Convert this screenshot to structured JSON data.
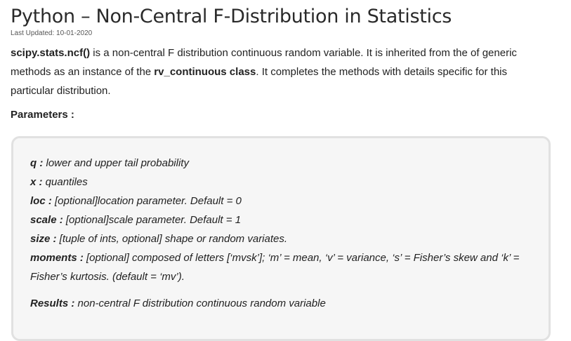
{
  "article": {
    "title": "Python – Non-Central F-Distribution in Statistics",
    "last_updated": "Last Updated: 10-01-2020",
    "intro": {
      "code1": "scipy.stats.ncf()",
      "text1": " is a non-central F distribution continuous random variable. It is inherited from the of generic methods as an instance of the ",
      "code2": "rv_continuous class",
      "text2": ". It completes the methods with details specific for this particular distribution."
    },
    "parameters_heading": "Parameters :",
    "parameters": [
      {
        "key": "q :",
        "desc": " lower and upper tail probability"
      },
      {
        "key": "x :",
        "desc": " quantiles"
      },
      {
        "key": "loc :",
        "desc": " [optional]location parameter. Default = 0"
      },
      {
        "key": "scale :",
        "desc": " [optional]scale parameter. Default = 1"
      },
      {
        "key": "size :",
        "desc": " [tuple of ints, optional] shape or random variates."
      },
      {
        "key": "moments :",
        "desc": " [optional] composed of letters [‘mvsk’]; ‘m’ = mean, ‘v’ = variance, ‘s’ = Fisher’s skew and ‘k’ = Fisher’s kurtosis. (default = ‘mv’)."
      }
    ],
    "results": {
      "key": "Results :",
      "desc": " non-central F distribution continuous random variable"
    }
  }
}
